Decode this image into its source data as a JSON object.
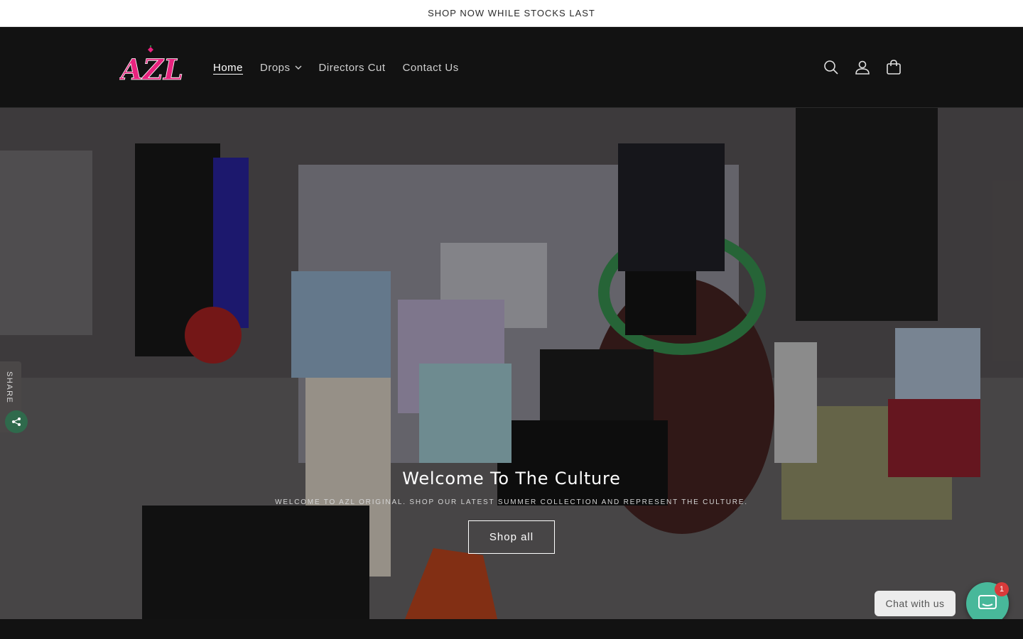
{
  "announcement": {
    "text": "SHOP NOW WHILE STOCKS LAST"
  },
  "header": {
    "logo_text": "AZL",
    "nav": [
      {
        "label": "Home",
        "active": true,
        "dropdown": false
      },
      {
        "label": "Drops",
        "active": false,
        "dropdown": true
      },
      {
        "label": "Directors Cut",
        "active": false,
        "dropdown": false
      },
      {
        "label": "Contact Us",
        "active": false,
        "dropdown": false
      }
    ],
    "icons": [
      "search-icon",
      "account-icon",
      "cart-icon"
    ]
  },
  "hero": {
    "title": "Welcome To The Culture",
    "subtitle": "WELCOME TO AZL ORIGINAL. SHOP OUR LATEST SUMMER COLLECTION AND REPRESENT THE CULTURE.",
    "button_label": "Shop all"
  },
  "share": {
    "label": "SHARE"
  },
  "chat": {
    "label": "Chat with us",
    "badge_count": "1"
  },
  "colors": {
    "header_bg": "#121212",
    "logo_pink": "#e8237e",
    "chat_green": "#48b89a",
    "badge_red": "#d93a3a"
  }
}
